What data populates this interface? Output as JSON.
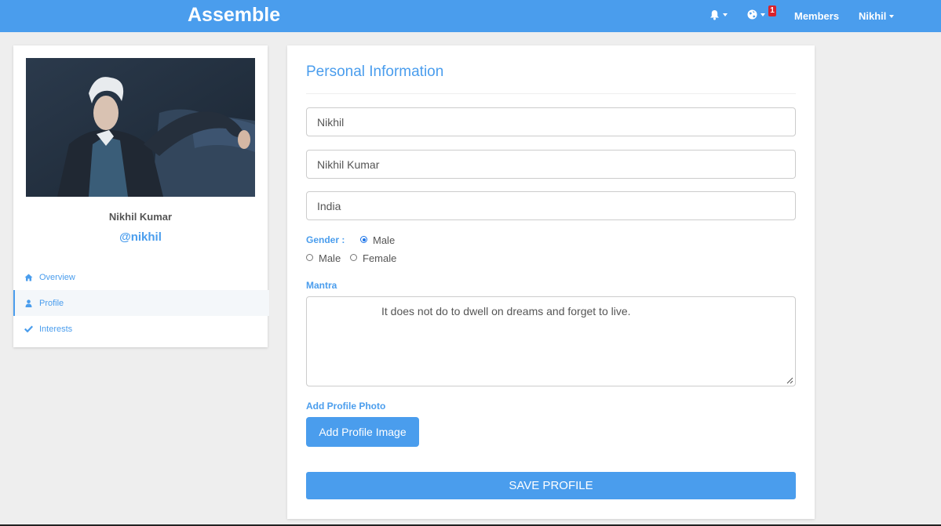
{
  "navbar": {
    "brand": "Assemble",
    "notification_badge": "1",
    "members_label": "Members",
    "user_label": "Nikhil",
    "icons": [
      "bell-icon",
      "globe-icon",
      "caret-down-icon"
    ]
  },
  "profile_card": {
    "name": "Nikhil Kumar",
    "handle": "@nikhil",
    "menu": [
      {
        "label": "Overview",
        "icon": "home-icon"
      },
      {
        "label": "Profile",
        "icon": "user-icon"
      },
      {
        "label": "Interests",
        "icon": "check-icon"
      }
    ],
    "active_menu": "Profile"
  },
  "form": {
    "title": "Personal Information",
    "first_name_value": "Nikhil",
    "full_name_value": "Nikhil Kumar",
    "country_value": "India",
    "gender_label": "Gender :",
    "gender_selected_label": "Male",
    "gender_options": [
      "Male",
      "Female"
    ],
    "mantra_label": "Mantra",
    "mantra_value": "It does not do to dwell on dreams and forget to live.",
    "photo_label": "Add Profile Photo",
    "add_image_button": "Add Profile Image",
    "save_button": "SAVE PROFILE"
  },
  "colors": {
    "accent": "#4a9ded",
    "badge": "#d9232d",
    "background": "#eeeeee"
  }
}
